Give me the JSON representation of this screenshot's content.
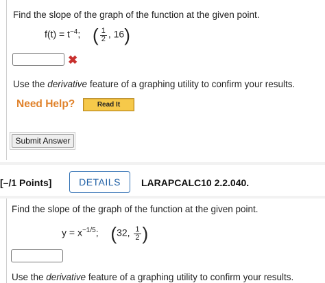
{
  "q1": {
    "prompt": "Find the slope of the graph of the function at the given point.",
    "func_lhs": "f(t) = t",
    "func_exp": "−4",
    "func_sep": ";",
    "point_num": "1",
    "point_den": "2",
    "point_y": "16",
    "answer_value": "",
    "derivative_pre": "Use the ",
    "derivative_em": "derivative",
    "derivative_post": " feature of a graphing utility to confirm your results.",
    "need_help": "Need Help?",
    "read_it": "Read It",
    "submit": "Submit Answer"
  },
  "q2": {
    "points": "[–/1 Points]",
    "details": "DETAILS",
    "code": "LARAPCALC10 2.2.040.",
    "prompt": "Find the slope of the graph of the function at the given point.",
    "func_lhs": "y = x",
    "func_exp": "−1/5",
    "func_sep": ";",
    "point_x": "32,",
    "point_num": "1",
    "point_den": "2",
    "answer_value": "",
    "derivative_pre": "Use the ",
    "derivative_em": "derivative",
    "derivative_post": " feature of a graphing utility to confirm your results."
  },
  "colors": {
    "details_border": "#2f6fb3",
    "need_help": "#e0822b",
    "read_it_bg": "#f6c94a",
    "incorrect": "#c8302e"
  },
  "icons": {
    "incorrect": "x-mark-icon"
  }
}
